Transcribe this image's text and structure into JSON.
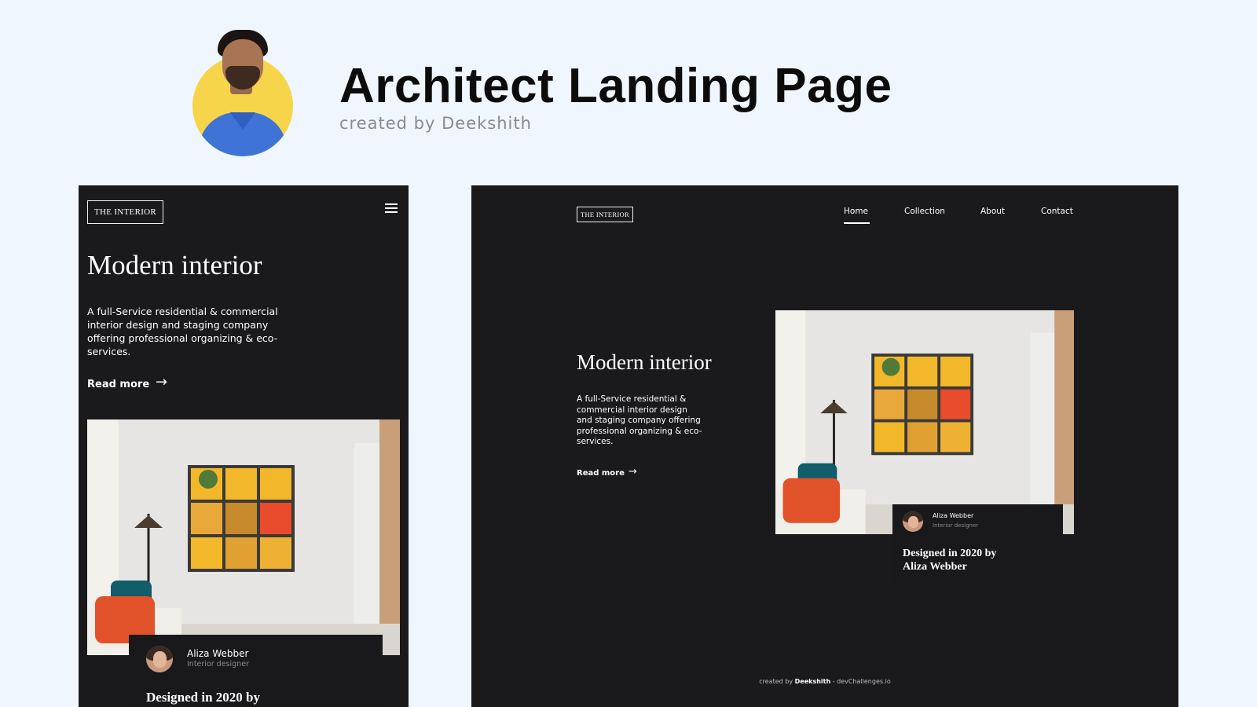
{
  "header": {
    "title": "Architect Landing Page",
    "subtitle": "created by Deekshith"
  },
  "site": {
    "logo": "THE INTERIOR",
    "hero_title": "Modern interior",
    "hero_desc": "A full-Service residential & commercial interior design and staging company offering professional organizing & eco-services.",
    "read_more": "Read more",
    "nav": [
      "Home",
      "Collection",
      "About",
      "Contact"
    ],
    "designer_name": "Aliza Webber",
    "designer_role": "Interior designer",
    "mobile_card_title": "Designed in 2020 by",
    "desktop_card_title": "Designed in 2020 by Aliza Webber",
    "footer_prefix": "created by",
    "footer_author": "Deekshith",
    "footer_suffix": "- devChallenges.io"
  },
  "colors": {
    "page_bg": "#eff6fe",
    "mock_bg": "#1a1a1c",
    "avatar_bg": "#f6d54a"
  },
  "icons": {
    "menu": "hamburger-menu-icon",
    "arrow": "arrow-right-icon"
  }
}
